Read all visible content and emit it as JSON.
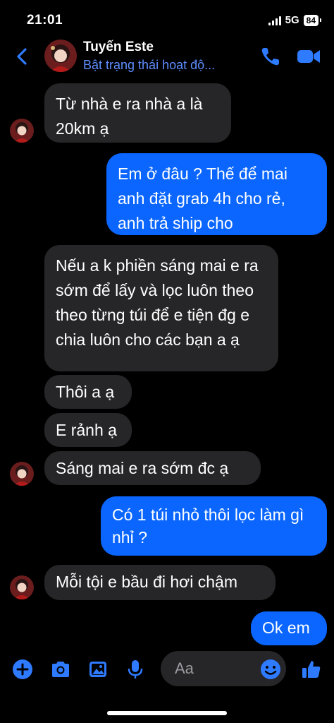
{
  "status_bar": {
    "time": "21:01",
    "network": "5G",
    "battery": "84"
  },
  "header": {
    "contact_name": "Tuyến Este",
    "status_text": "Bật trạng thái hoạt độ...",
    "icons": [
      "back-chevron",
      "phone",
      "video-camera"
    ]
  },
  "messages": [
    {
      "side": "in",
      "text": "Từ nhà e ra nhà a là 20km ạ"
    },
    {
      "side": "out",
      "text": "Em ở đâu ? Thế để mai anh đặt grab 4h cho rẻ, anh trả ship cho"
    },
    {
      "side": "in",
      "text": "Nếu a k phiền sáng mai e ra sớm để lấy và lọc luôn theo theo từng túi để e tiện đg e chia luôn cho các bạn a ạ"
    },
    {
      "side": "in",
      "text": "Thôi a ạ"
    },
    {
      "side": "in",
      "text": "E rảnh ạ"
    },
    {
      "side": "in",
      "text": "Sáng mai e ra sớm đc ạ"
    },
    {
      "side": "out",
      "text": "Có 1 túi nhỏ thôi lọc làm gì nhỉ ?"
    },
    {
      "side": "in",
      "text": "Mỗi tội e bầu đi hơi chậm"
    },
    {
      "side": "out",
      "text": "Ok em"
    }
  ],
  "composer": {
    "placeholder": "Aa",
    "icons": [
      "plus",
      "camera",
      "image",
      "microphone",
      "emoji",
      "thumbs-up"
    ]
  },
  "colors": {
    "accent": "#0a66ff",
    "incoming_bubble": "#262628",
    "status_text": "#5f8dff"
  }
}
